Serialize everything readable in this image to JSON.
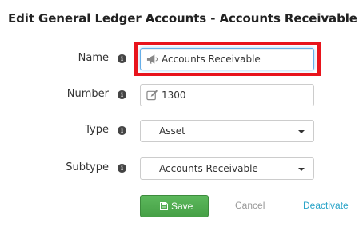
{
  "header": {
    "title": "Edit General Ledger Accounts - Accounts Receivable"
  },
  "form": {
    "name": {
      "label": "Name",
      "value": "Accounts Receivable",
      "icon": "bullhorn-icon"
    },
    "number": {
      "label": "Number",
      "value": "1300",
      "icon": "pencil-square-icon"
    },
    "type": {
      "label": "Type",
      "selected": "Asset"
    },
    "subtype": {
      "label": "Subtype",
      "selected": "Accounts Receivable"
    }
  },
  "actions": {
    "save_label": "Save",
    "cancel_label": "Cancel",
    "deactivate_label": "Deactivate"
  },
  "colors": {
    "save_button": "#5cb85c",
    "deactivate_link": "#2aa4c8",
    "highlight": "#e8141c",
    "focus": "#66afe9"
  }
}
